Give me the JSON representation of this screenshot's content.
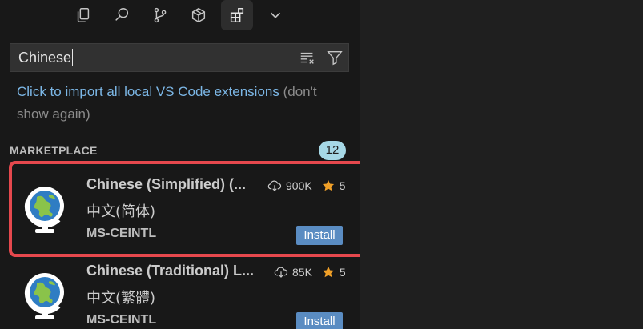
{
  "toolbar": {
    "items": [
      {
        "icon": "copy-icon"
      },
      {
        "icon": "search-icon"
      },
      {
        "icon": "source-control-icon"
      },
      {
        "icon": "cube-icon"
      },
      {
        "icon": "extensions-icon",
        "active": true
      },
      {
        "icon": "chevron-down-icon"
      }
    ]
  },
  "search": {
    "value": "Chinese",
    "clear_icon": "clear-filter-icon",
    "filter_icon": "filter-icon"
  },
  "notice": {
    "link_text": "Click to import all local VS Code extensions",
    "dismiss_text": "(don't show again)"
  },
  "marketplace": {
    "title": "MARKETPLACE",
    "count": "12",
    "items": [
      {
        "name": "Chinese (Simplified) (...",
        "description": "中文(简体)",
        "publisher": "MS-CEINTL",
        "downloads": "900K",
        "rating": "5",
        "install_label": "Install"
      },
      {
        "name": "Chinese (Traditional) L...",
        "description": "中文(繁體)",
        "publisher": "MS-CEINTL",
        "downloads": "85K",
        "rating": "5",
        "install_label": "Install"
      }
    ]
  },
  "colors": {
    "accent_link": "#7cb7e6",
    "install_button": "#5a8cc2",
    "count_badge": "#a6d8e6",
    "star": "#f0a028",
    "highlight": "#e5484d"
  }
}
